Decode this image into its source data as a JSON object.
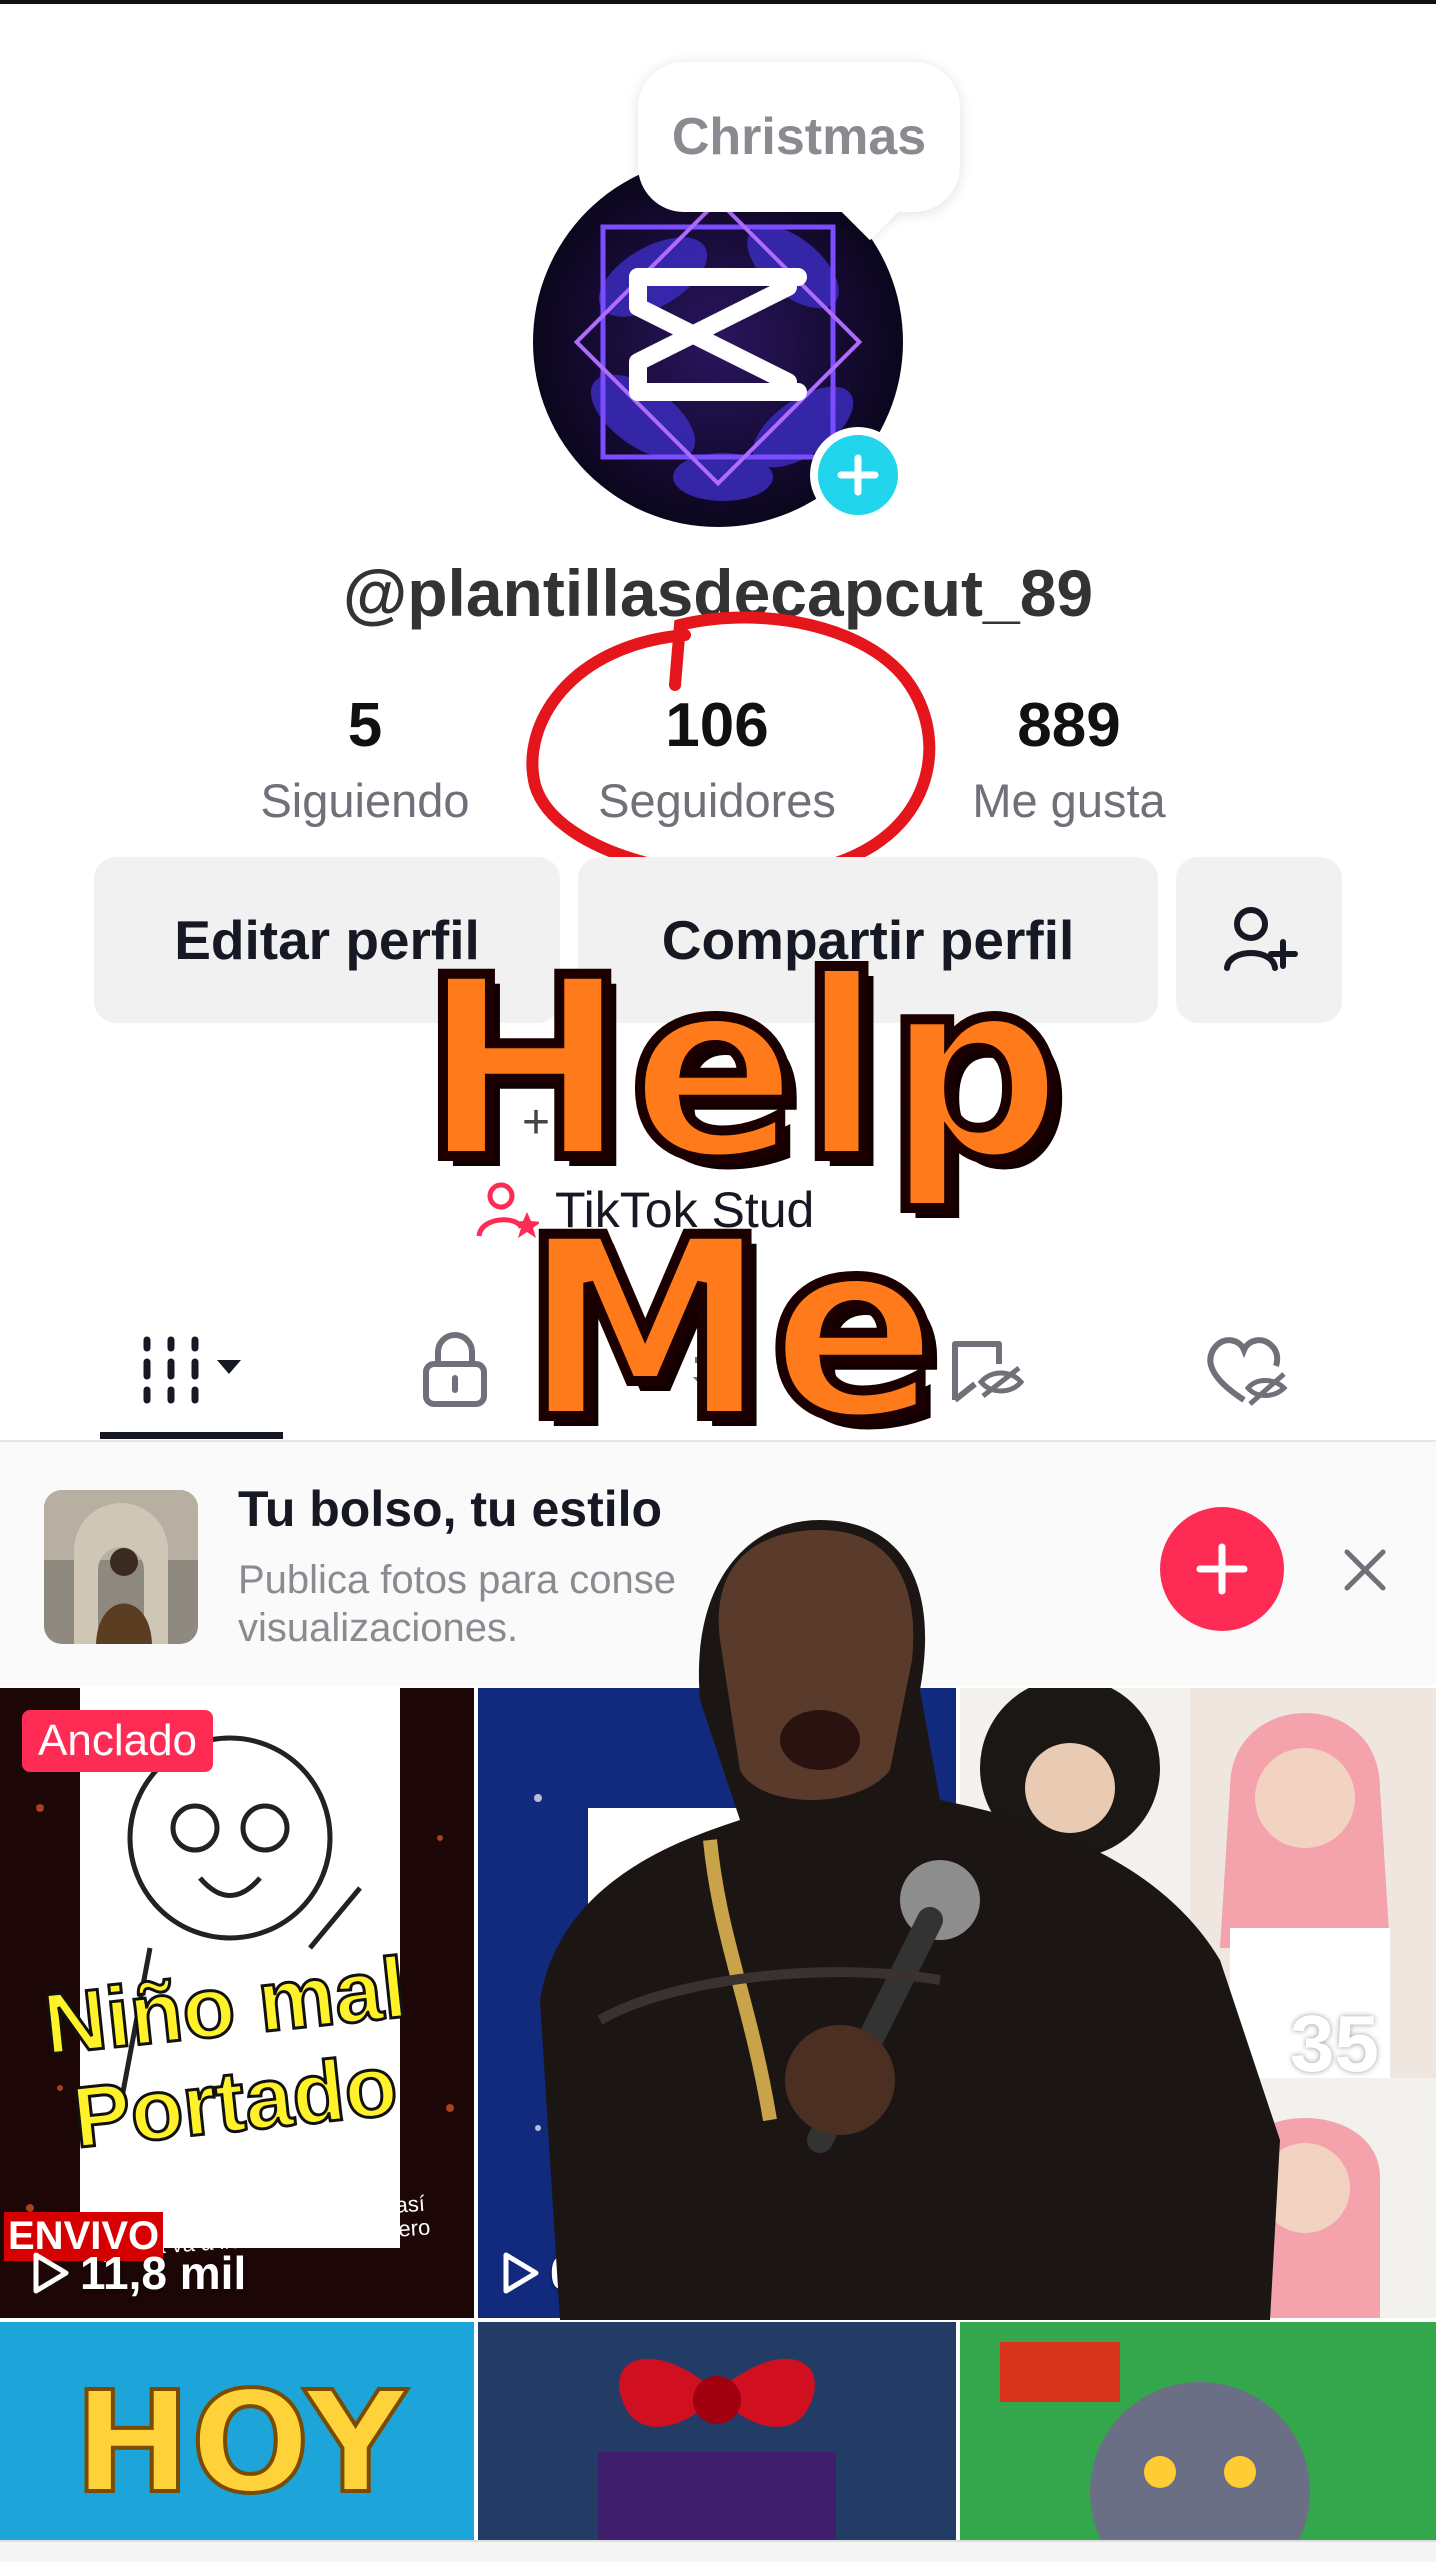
{
  "tooltip": {
    "label": "Christmas"
  },
  "profile": {
    "username": "@plantillasdecapcut_89",
    "stats": [
      {
        "value": "5",
        "label": "Siguiendo"
      },
      {
        "value": "106",
        "label": "Seguidores"
      },
      {
        "value": "889",
        "label": "Me gusta"
      }
    ]
  },
  "actions": {
    "edit_label": "Editar perfil",
    "share_label": "Compartir perfil",
    "add_friend_icon": "add-friend-icon"
  },
  "extras": {
    "studio_label": "TikTok Stud",
    "plus_label": "+"
  },
  "tabs": [
    {
      "icon": "grid-icon",
      "active": true
    },
    {
      "icon": "lock-icon"
    },
    {
      "icon": "repost-icon"
    },
    {
      "icon": "tagged-icon"
    },
    {
      "icon": "liked-icon"
    }
  ],
  "promo": {
    "title": "Tu bolso, tu estilo",
    "description": "Publica fotos para conse visualizaciones.",
    "add_icon": "plus-icon",
    "close_icon": "close-icon"
  },
  "videos": [
    {
      "pinned_label": "Anclado",
      "caption_top": "Niño mal",
      "caption_bottom": "Portado",
      "small_text": "Este niño se porta mal y si sigue así La policía va a llevárselo por grosero",
      "views": "11,8 mil",
      "tag": "ENVIVO"
    },
    {
      "views": "0"
    },
    {
      "badge": "35"
    },
    {
      "caption": "HOY"
    },
    {},
    {}
  ],
  "overlay": {
    "line1": "Help",
    "line2": "Me"
  },
  "colors": {
    "accent": "#fe2c55",
    "teal": "#20d5ec",
    "orange": "#ff7a1a"
  }
}
